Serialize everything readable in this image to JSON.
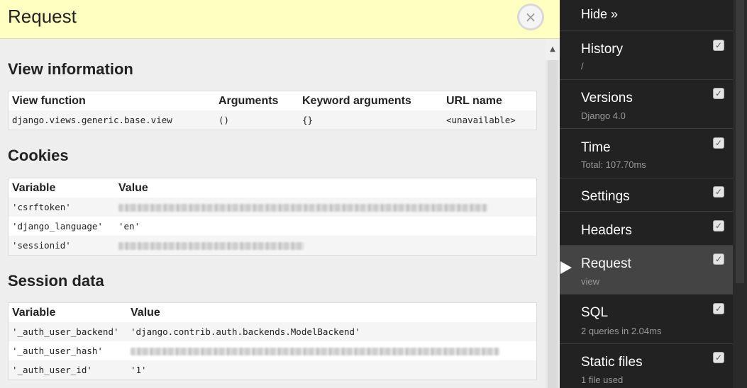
{
  "panel": {
    "title": "Request",
    "close_glyph": "×",
    "view_info": {
      "heading": "View information",
      "headers": [
        "View function",
        "Arguments",
        "Keyword arguments",
        "URL name"
      ],
      "row": [
        "django.views.generic.base.view",
        "()",
        "{}",
        "<unavailable>"
      ]
    },
    "cookies": {
      "heading": "Cookies",
      "headers": [
        "Variable",
        "Value"
      ],
      "rows": [
        {
          "variable": "'csrftoken'",
          "value_redacted": true
        },
        {
          "variable": "'django_language'",
          "value": "'en'"
        },
        {
          "variable": "'sessionid'",
          "value_redacted": true
        }
      ]
    },
    "session": {
      "heading": "Session data",
      "headers": [
        "Variable",
        "Value"
      ],
      "rows": [
        {
          "variable": "'_auth_user_backend'",
          "value": "'django.contrib.auth.backends.ModelBackend'"
        },
        {
          "variable": "'_auth_user_hash'",
          "value_redacted": true
        },
        {
          "variable": "'_auth_user_id'",
          "value": "'1'"
        }
      ]
    }
  },
  "toolbar": {
    "hide_label": "Hide »",
    "items": [
      {
        "title": "History",
        "subtitle": "/",
        "checked": true
      },
      {
        "title": "Versions",
        "subtitle": "Django 4.0",
        "checked": true
      },
      {
        "title": "Time",
        "subtitle": "Total: 107.70ms",
        "checked": true
      },
      {
        "title": "Settings",
        "subtitle": "",
        "checked": true
      },
      {
        "title": "Headers",
        "subtitle": "",
        "checked": true
      },
      {
        "title": "Request",
        "subtitle": "view",
        "checked": true,
        "active": true
      },
      {
        "title": "SQL",
        "subtitle": "2 queries in 2.04ms",
        "checked": true
      },
      {
        "title": "Static files",
        "subtitle": "1 file used",
        "checked": true
      }
    ],
    "colors": {
      "background": "#222222",
      "active": "#444444",
      "subtitle": "#999999"
    }
  }
}
